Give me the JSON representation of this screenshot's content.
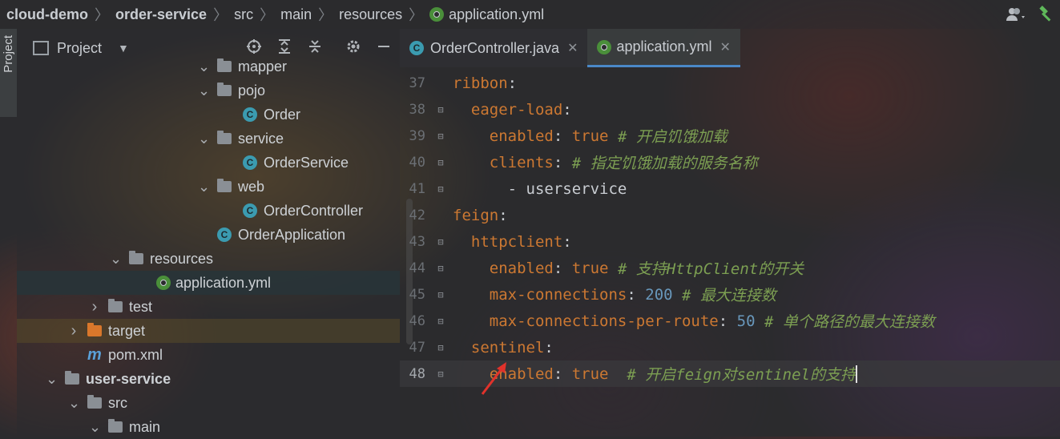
{
  "breadcrumb": [
    "cloud-demo",
    "order-service",
    "src",
    "main",
    "resources",
    "application.yml"
  ],
  "side_tab_label": "Project",
  "project_panel": {
    "title": "Project",
    "tree": [
      {
        "label": "mapper",
        "kind": "folder",
        "depth": 9,
        "expanded": true
      },
      {
        "label": "pojo",
        "kind": "folder",
        "depth": 9,
        "expanded": true
      },
      {
        "label": "Order",
        "kind": "class",
        "depth": 10
      },
      {
        "label": "service",
        "kind": "folder",
        "depth": 9,
        "expanded": true
      },
      {
        "label": "OrderService",
        "kind": "class",
        "depth": 10
      },
      {
        "label": "web",
        "kind": "folder",
        "depth": 9,
        "expanded": true
      },
      {
        "label": "OrderController",
        "kind": "class",
        "depth": 10
      },
      {
        "label": "OrderApplication",
        "kind": "spring-class",
        "depth": 9
      },
      {
        "label": "resources",
        "kind": "resources-folder",
        "depth": 5,
        "expanded": true
      },
      {
        "label": "application.yml",
        "kind": "yml",
        "depth": 6,
        "selected": true
      },
      {
        "label": "test",
        "kind": "folder",
        "depth": 4,
        "expanded": false
      },
      {
        "label": "target",
        "kind": "orange-folder",
        "depth": 3,
        "expanded": false,
        "highlight": true
      },
      {
        "label": "pom.xml",
        "kind": "maven",
        "depth": 3
      },
      {
        "label": "user-service",
        "kind": "module-folder",
        "depth": 2,
        "expanded": true,
        "bold": true
      },
      {
        "label": "src",
        "kind": "folder",
        "depth": 3,
        "expanded": true
      },
      {
        "label": "main",
        "kind": "folder",
        "depth": 4,
        "expanded": true
      }
    ]
  },
  "editor": {
    "tabs": [
      {
        "label": "OrderController.java",
        "icon": "class-icon",
        "active": false
      },
      {
        "label": "application.yml",
        "icon": "yml-icon",
        "active": true
      }
    ],
    "lines": [
      {
        "no": "37",
        "indent": "",
        "key": "ribbon",
        "colon": ":",
        "value": "",
        "vtype": "",
        "comment": ""
      },
      {
        "no": "38",
        "indent": "  ",
        "key": "eager-load",
        "colon": ":",
        "value": "",
        "vtype": "",
        "comment": ""
      },
      {
        "no": "39",
        "indent": "    ",
        "key": "enabled",
        "colon": ": ",
        "value": "true",
        "vtype": "v",
        "comment": " # 开启饥饿加载"
      },
      {
        "no": "40",
        "indent": "    ",
        "key": "clients",
        "colon": ": ",
        "value": "",
        "vtype": "",
        "comment": "# 指定饥饿加载的服务名称"
      },
      {
        "no": "41",
        "indent": "      ",
        "key": "",
        "colon": "- ",
        "value": "userservice",
        "vtype": "s",
        "comment": ""
      },
      {
        "no": "42",
        "indent": "",
        "key": "feign",
        "colon": ":",
        "value": "",
        "vtype": "",
        "comment": ""
      },
      {
        "no": "43",
        "indent": "  ",
        "key": "httpclient",
        "colon": ":",
        "value": "",
        "vtype": "",
        "comment": ""
      },
      {
        "no": "44",
        "indent": "    ",
        "key": "enabled",
        "colon": ": ",
        "value": "true",
        "vtype": "v",
        "comment": " # 支持HttpClient的开关"
      },
      {
        "no": "45",
        "indent": "    ",
        "key": "max-connections",
        "colon": ": ",
        "value": "200",
        "vtype": "n",
        "comment": " # 最大连接数"
      },
      {
        "no": "46",
        "indent": "    ",
        "key": "max-connections-per-route",
        "colon": ": ",
        "value": "50",
        "vtype": "n",
        "comment": " # 单个路径的最大连接数"
      },
      {
        "no": "47",
        "indent": "  ",
        "key": "sentinel",
        "colon": ":",
        "value": "",
        "vtype": "",
        "comment": ""
      },
      {
        "no": "48",
        "indent": "    ",
        "key": "enabled",
        "colon": ": ",
        "value": "true",
        "vtype": "v",
        "comment": "  # 开启feign对sentinel的支持",
        "current": true
      }
    ]
  },
  "colors": {
    "key": "#cc7832",
    "number": "#6897bb",
    "comment": "#7c9f52",
    "arrow": "#e0322b"
  }
}
